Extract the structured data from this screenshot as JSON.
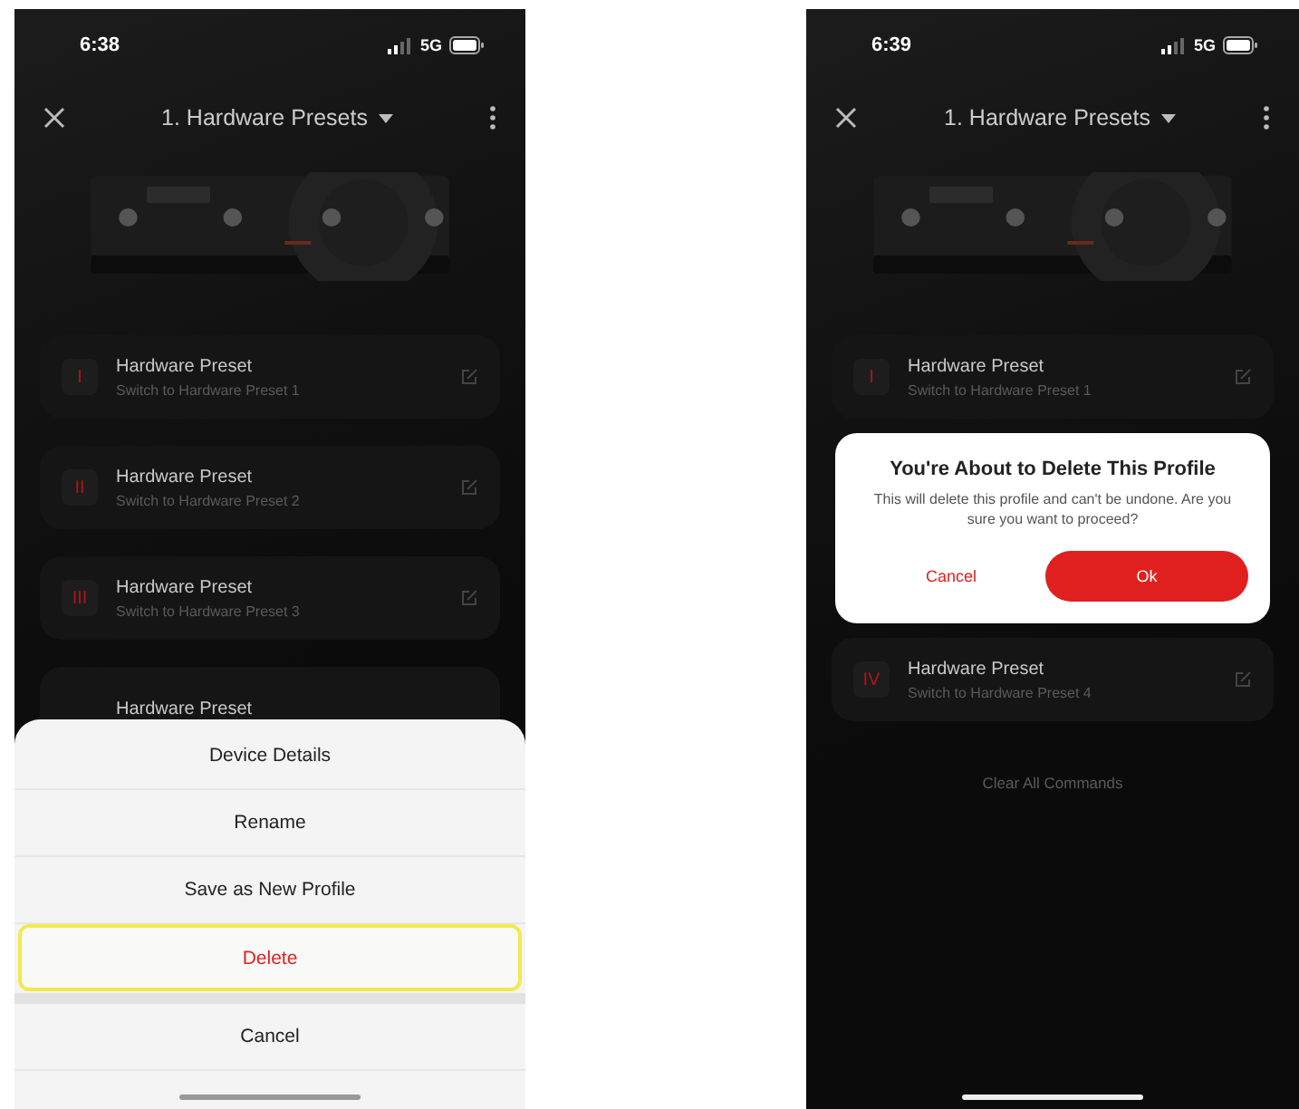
{
  "screens": [
    {
      "status_bar": {
        "time": "6:38",
        "network": "5G"
      },
      "header": {
        "title": "1. Hardware Presets"
      },
      "device_image": {
        "kind": "picture"
      },
      "presets": [
        {
          "numeral": "I",
          "title": "Hardware Preset",
          "subtitle": "Switch to Hardware Preset 1"
        },
        {
          "numeral": "II",
          "title": "Hardware Preset",
          "subtitle": "Switch to Hardware Preset 2"
        },
        {
          "numeral": "III",
          "title": "Hardware Preset",
          "subtitle": "Switch to Hardware Preset 3"
        },
        {
          "title": "Hardware Preset"
        }
      ],
      "action_sheet": {
        "items": [
          {
            "label": "Device Details",
            "kind": "normal",
            "selected": false
          },
          {
            "label": "Rename",
            "kind": "normal",
            "selected": false
          },
          {
            "label": "Save as New Profile",
            "kind": "normal",
            "selected": false
          },
          {
            "label": "Delete",
            "kind": "destructive",
            "selected": true
          },
          {
            "label": "Cancel",
            "kind": "cancel",
            "selected": false
          }
        ]
      }
    },
    {
      "status_bar": {
        "time": "6:39",
        "network": "5G"
      },
      "header": {
        "title": "1. Hardware Presets"
      },
      "device_image": {
        "kind": "picture"
      },
      "presets": [
        {
          "numeral": "I",
          "title": "Hardware Preset",
          "subtitle": "Switch to Hardware Preset 1"
        }
      ],
      "dialog": {
        "title": "You're About to Delete This Profile",
        "message": "This will delete this profile and can't be undone. Are you sure you want to proceed?",
        "buttons": [
          {
            "label": "Cancel",
            "kind": "text"
          },
          {
            "label": "Ok",
            "kind": "primary"
          }
        ]
      },
      "presets_after": [
        {
          "numeral": "IV",
          "title": "Hardware Preset",
          "subtitle": "Switch to Hardware Preset 4"
        }
      ],
      "footer_link": "Clear All Commands"
    }
  ]
}
